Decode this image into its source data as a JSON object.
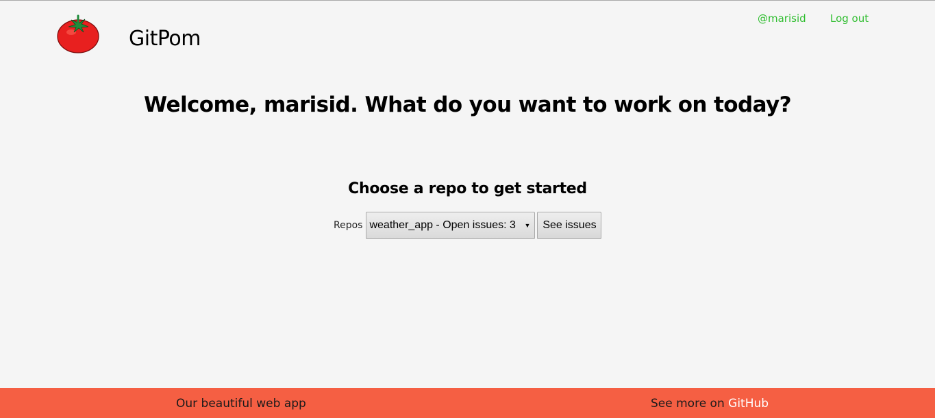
{
  "header": {
    "brand": "GitPom",
    "logo_icon": "tomato-icon",
    "nav": {
      "user_link": "@marisid",
      "logout_link": "Log out"
    }
  },
  "main": {
    "welcome": "Welcome, marisid. What do you want to work on today?",
    "prompt": "Choose a repo to get started",
    "repo_label": "Repos",
    "repo_selected": "weather_app - Open issues: 3",
    "see_issues_label": "See issues"
  },
  "footer": {
    "left_text": "Our beautiful web app",
    "right_text": "See more on",
    "right_link": "GitHub"
  },
  "colors": {
    "background": "#f5f5f5",
    "link_green": "#2ebd2e",
    "footer_bg": "#f55f43",
    "tomato_red": "#e8201f",
    "leaf_green": "#1e8c3a"
  }
}
